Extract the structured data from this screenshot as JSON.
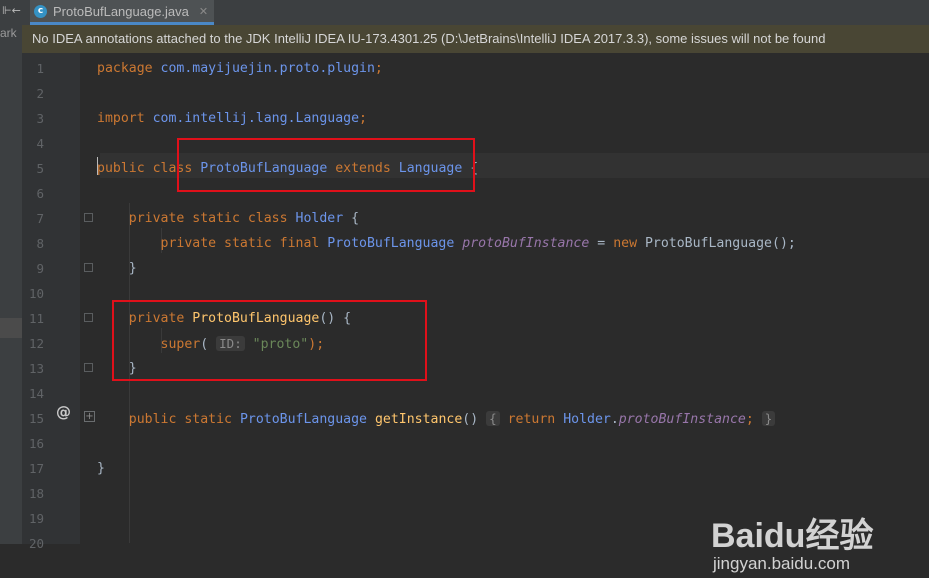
{
  "tab": {
    "file_name": "ProtoBufLanguage.java",
    "icon": "java-class-icon"
  },
  "left_strip": {
    "cut_text": "ark"
  },
  "banner": {
    "message": "No IDEA annotations attached to the JDK IntelliJ IDEA IU-173.4301.25 (D:\\JetBrains\\IntelliJ IDEA 2017.3.3), some issues will not be found"
  },
  "editor": {
    "lines": [
      "1",
      "2",
      "3",
      "4",
      "5",
      "6",
      "7",
      "8",
      "9",
      "10",
      "11",
      "12",
      "13",
      "14",
      "15",
      "16",
      "17",
      "18",
      "19",
      "20"
    ],
    "code": {
      "l1_kw": "package",
      "l1_pkg": "com.mayijuejin.proto.plugin",
      "l1_semi": ";",
      "l3_kw": "import",
      "l3_pkg": "com.intellij.lang.Language",
      "l3_semi": ";",
      "l5_kw1": "public class",
      "l5_cls": "ProtoBufLanguage",
      "l5_kw2": "extends",
      "l5_sup": "Language",
      "l5_brace": "{",
      "l7_kw": "private static class",
      "l7_cls": "Holder",
      "l7_brace": "{",
      "l8_kw": "private static final",
      "l8_type": "ProtoBufLanguage",
      "l8_field": "protoBufInstance",
      "l8_eq": "=",
      "l8_new": "new",
      "l8_ctor": "ProtoBufLanguage",
      "l8_end": "();",
      "l9": "}",
      "l11_kw": "private",
      "l11_mth": "ProtoBufLanguage",
      "l11_rest": "() {",
      "l12_kw": "super",
      "l12_open": "(",
      "l12_hint": "ID:",
      "l12_str": "\"proto\"",
      "l12_close": ");",
      "l13": "}",
      "l15_kw": "public static",
      "l15_type": "ProtoBufLanguage",
      "l15_mth": "getInstance",
      "l15_paren": "()",
      "l15_open": "{",
      "l15_ret": "return",
      "l15_holder": "Holder",
      "l15_dot": ".",
      "l15_field": "protoBufInstance",
      "l15_semi": ";",
      "l15_close": "}",
      "l17": "}"
    },
    "override_marker": "@"
  },
  "watermark": {
    "brand": "Baidu经验",
    "url": "jingyan.baidu.com"
  }
}
